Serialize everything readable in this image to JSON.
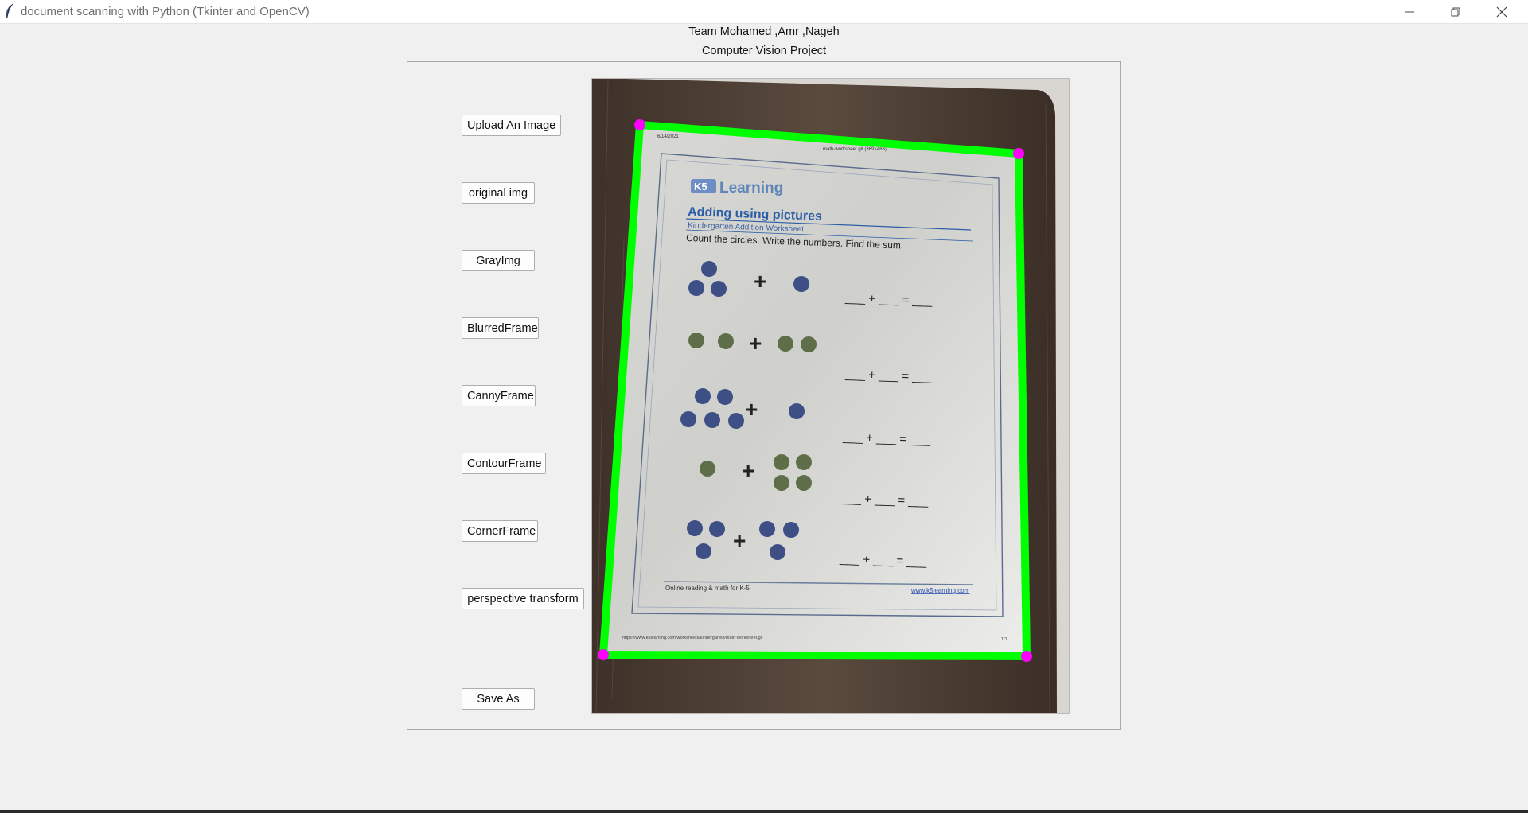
{
  "window": {
    "title": "document scanning with Python (Tkinter and OpenCV)"
  },
  "header": {
    "team": "Team Mohamed ,Amr ,Nageh",
    "project": "Computer Vision Project"
  },
  "buttons": {
    "upload": "Upload An Image",
    "original": "original img",
    "gray": "GrayImg",
    "blurred": "BlurredFrame",
    "canny": "CannyFrame",
    "contour": "ContourFrame",
    "corner": "CornerFrame",
    "perspective": "perspective transform",
    "save": "Save As"
  },
  "document": {
    "date": "6/14/2021",
    "file": "math-worksheet.gif (369×463)",
    "logo": "K5 Learning",
    "title": "Adding using pictures",
    "subtitle": "Kindergarten Addition Worksheet",
    "instructions": "Count the circles. Write the numbers. Find the sum.",
    "equation": "___ + ___ = ___",
    "footer_left": "Online reading & math for K-5",
    "footer_right": "www.k5learning.com",
    "url": "https://www.k5learning.com/worksheets/kindergarten/math-worksheet.gif",
    "page": "1/1"
  },
  "colors": {
    "contour": "#00ff00",
    "corner": "#ff00ff",
    "wood": "#4a3b30",
    "paper": "#e6e6e3",
    "blue_circle": "#3e4f86",
    "green_circle": "#5e6e48",
    "title_blue": "#2b5ea6"
  }
}
